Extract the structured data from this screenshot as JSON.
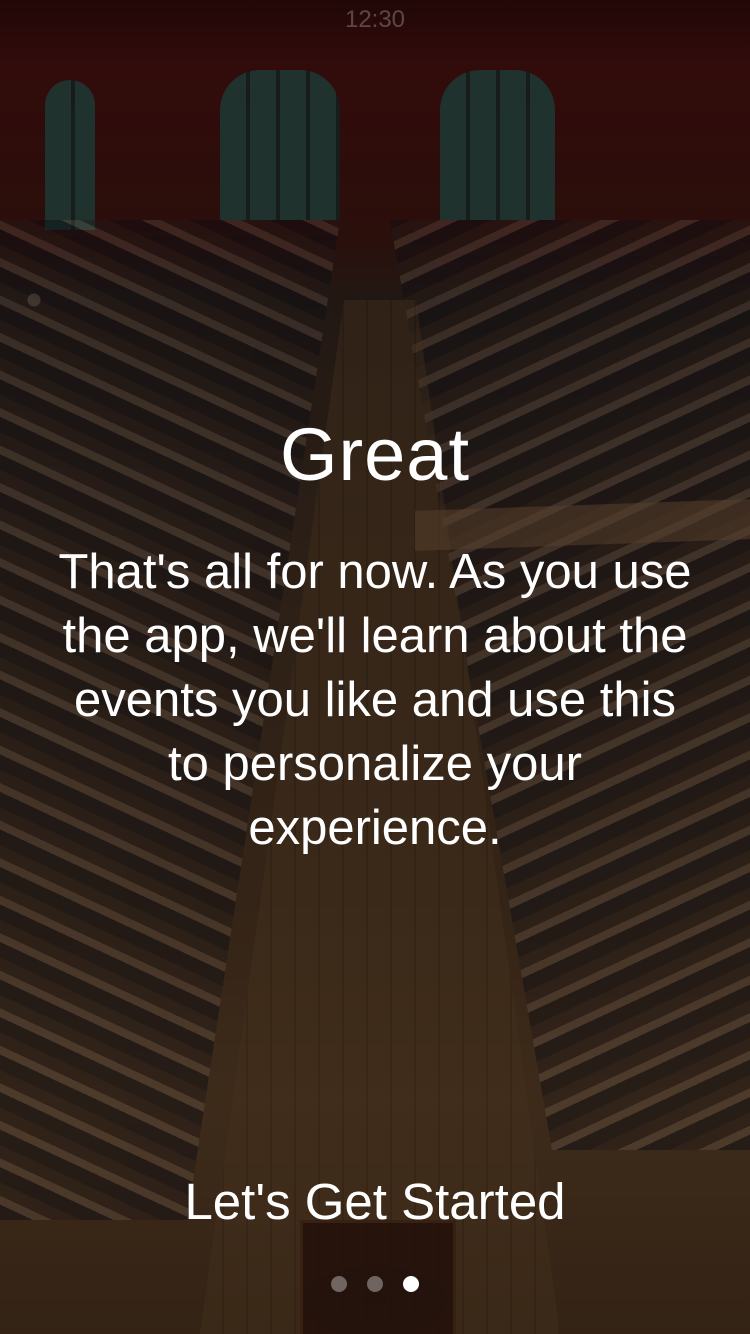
{
  "status_bar": {
    "time": "12:30"
  },
  "onboarding": {
    "title": "Great",
    "message": "That's all for now. As you use the app, we'll learn about the events you like and use this to personalize your experience.",
    "cta_label": "Let's Get Started",
    "page_indicator": {
      "total": 3,
      "current": 3
    }
  },
  "colors": {
    "text": "#ffffff",
    "dot_inactive": "rgba(255,255,255,0.35)",
    "dot_active": "#ffffff"
  }
}
